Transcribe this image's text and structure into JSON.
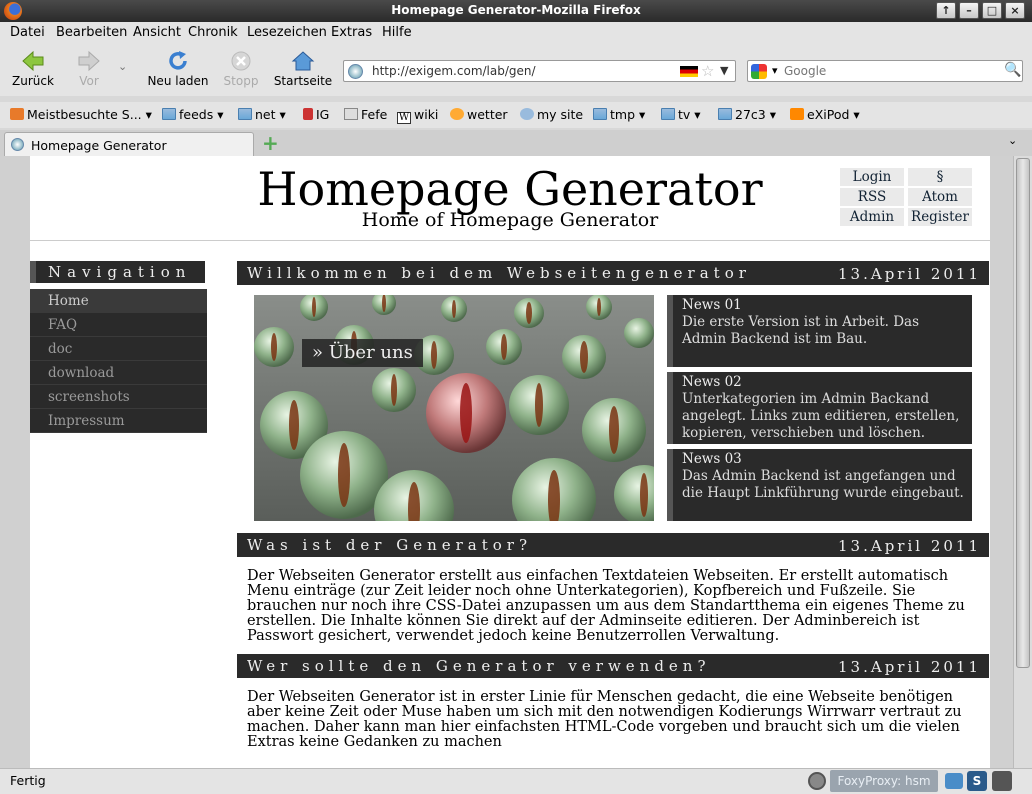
{
  "window": {
    "title": "Homepage Generator-Mozilla Firefox",
    "controls": [
      "↑",
      "–",
      "□",
      "×"
    ]
  },
  "menu": [
    "Datei",
    "Bearbeiten",
    "Ansicht",
    "Chronik",
    "Lesezeichen",
    "Extras",
    "Hilfe"
  ],
  "nav": {
    "back": "Zurück",
    "forward": "Vor",
    "reload": "Neu laden",
    "stop": "Stopp",
    "home": "Startseite"
  },
  "url": "http://exigem.com/lab/gen/",
  "search": {
    "placeholder": "Google"
  },
  "bookmarks": [
    "Meistbesuchte S...",
    "feeds",
    "net",
    "IG",
    "Fefe",
    "wiki",
    "wetter",
    "my site",
    "tmp",
    "tv",
    "27c3",
    "eXiPod"
  ],
  "tab": {
    "title": "Homepage Generator"
  },
  "status": {
    "text": "Fertig",
    "proxy": "FoxyProxy: hsm"
  },
  "page": {
    "title": "Homepage Generator",
    "subtitle": "Home of Homepage Generator",
    "userlinks": [
      "Login",
      "§",
      "RSS",
      "Atom",
      "Admin",
      "Register"
    ],
    "navigation": {
      "heading": "Navigation",
      "items": [
        "Home",
        "FAQ",
        "doc",
        "download",
        "screenshots",
        "Impressum"
      ]
    },
    "sections": [
      {
        "heading": "Willkommen bei dem Webseitengenerator",
        "date": "13.April 2011"
      },
      {
        "heading": "Was ist der Generator?",
        "date": "13.April 2011",
        "text": "Der Webseiten Generator erstellt aus einfachen Textdateien Webseiten. Er erstellt automatisch Menu einträge (zur Zeit leider noch ohne Unterkategorien), Kopfbereich und Fußzeile. Sie brauchen nur noch ihre CSS-Datei anzupassen um aus dem Standartthema ein eigenes Theme zu erstellen. Die Inhalte können Sie direkt auf der Adminseite editieren. Der Adminbereich ist Passwort gesichert, verwendet jedoch keine Benutzerrollen Verwaltung."
      },
      {
        "heading": "Wer sollte den Generator verwenden?",
        "date": "13.April 2011",
        "text": "Der Webseiten Generator ist in erster Linie für Menschen gedacht, die eine Webseite benötigen aber keine Zeit oder Muse haben um sich mit den notwendigen Kodierungs Wirrwarr vertraut zu machen. Daher kann man hier einfachsten HTML-Code vorgeben und braucht sich um die vielen Extras keine Gedanken zu machen"
      }
    ],
    "hero_button": "» Über uns",
    "news": [
      {
        "title": "News 01",
        "text": "Die erste Version ist in Arbeit. Das Admin Backend ist im Bau."
      },
      {
        "title": "News 02",
        "text": "Unterkategorien im Admin Backand angelegt. Links zum editieren, erstellen, kopieren, verschieben und löschen."
      },
      {
        "title": "News 03",
        "text": "Das Admin Backend ist angefangen und die Haupt Linkführung wurde eingebaut."
      }
    ]
  }
}
